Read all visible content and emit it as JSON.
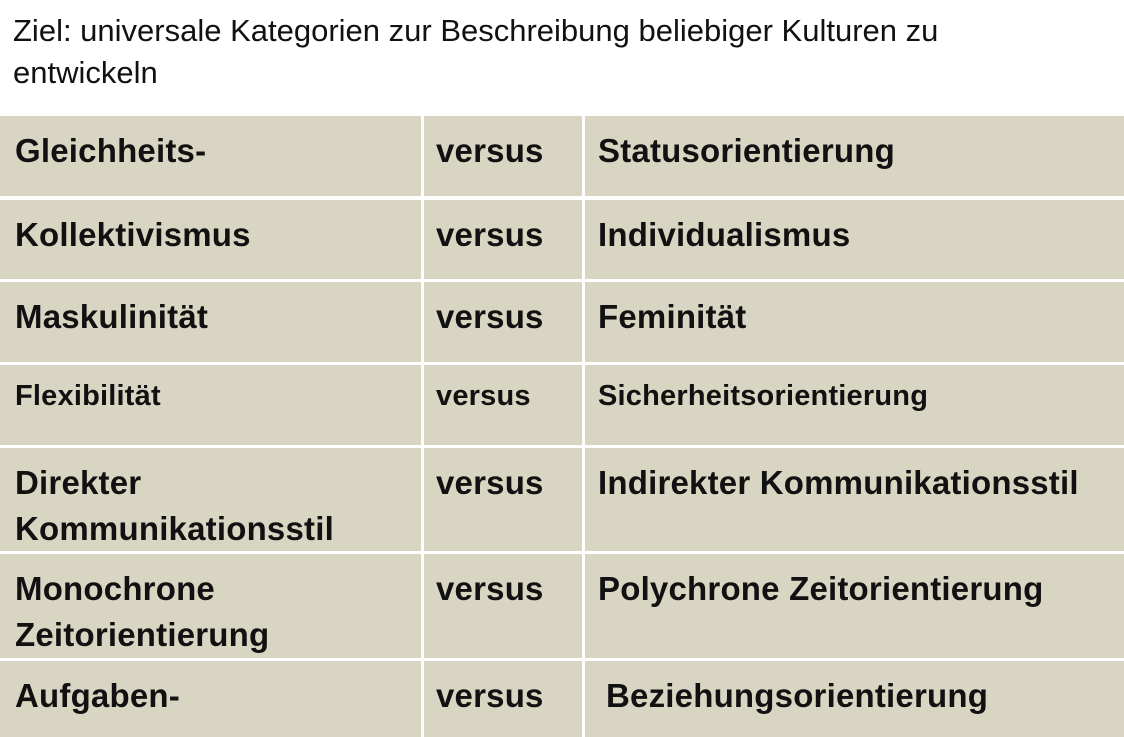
{
  "heading": "Ziel: universale Kategorien zur Beschreibung beliebiger Kulturen zu entwickeln",
  "rows": [
    {
      "left": "Gleichheits-",
      "middle": "versus",
      "right": "Statusorientierung"
    },
    {
      "left": "Kollektivismus",
      "middle": "versus",
      "right": "Individualismus"
    },
    {
      "left": "Maskulinität",
      "middle": "versus",
      "right": "Feminität"
    },
    {
      "left": "Flexibilität",
      "middle": "versus",
      "right": "Sicherheitsorientierung"
    },
    {
      "left": "Direkter Kommunikationsstil",
      "middle": "versus",
      "right": "Indirekter Kommunikationsstil"
    },
    {
      "left": "Monochrone Zeitorientierung",
      "middle": "versus",
      "right": "Polychrone Zeitorientierung"
    },
    {
      "left": "Aufgaben-",
      "middle": "versus",
      "right": "Beziehungsorientierung"
    }
  ]
}
